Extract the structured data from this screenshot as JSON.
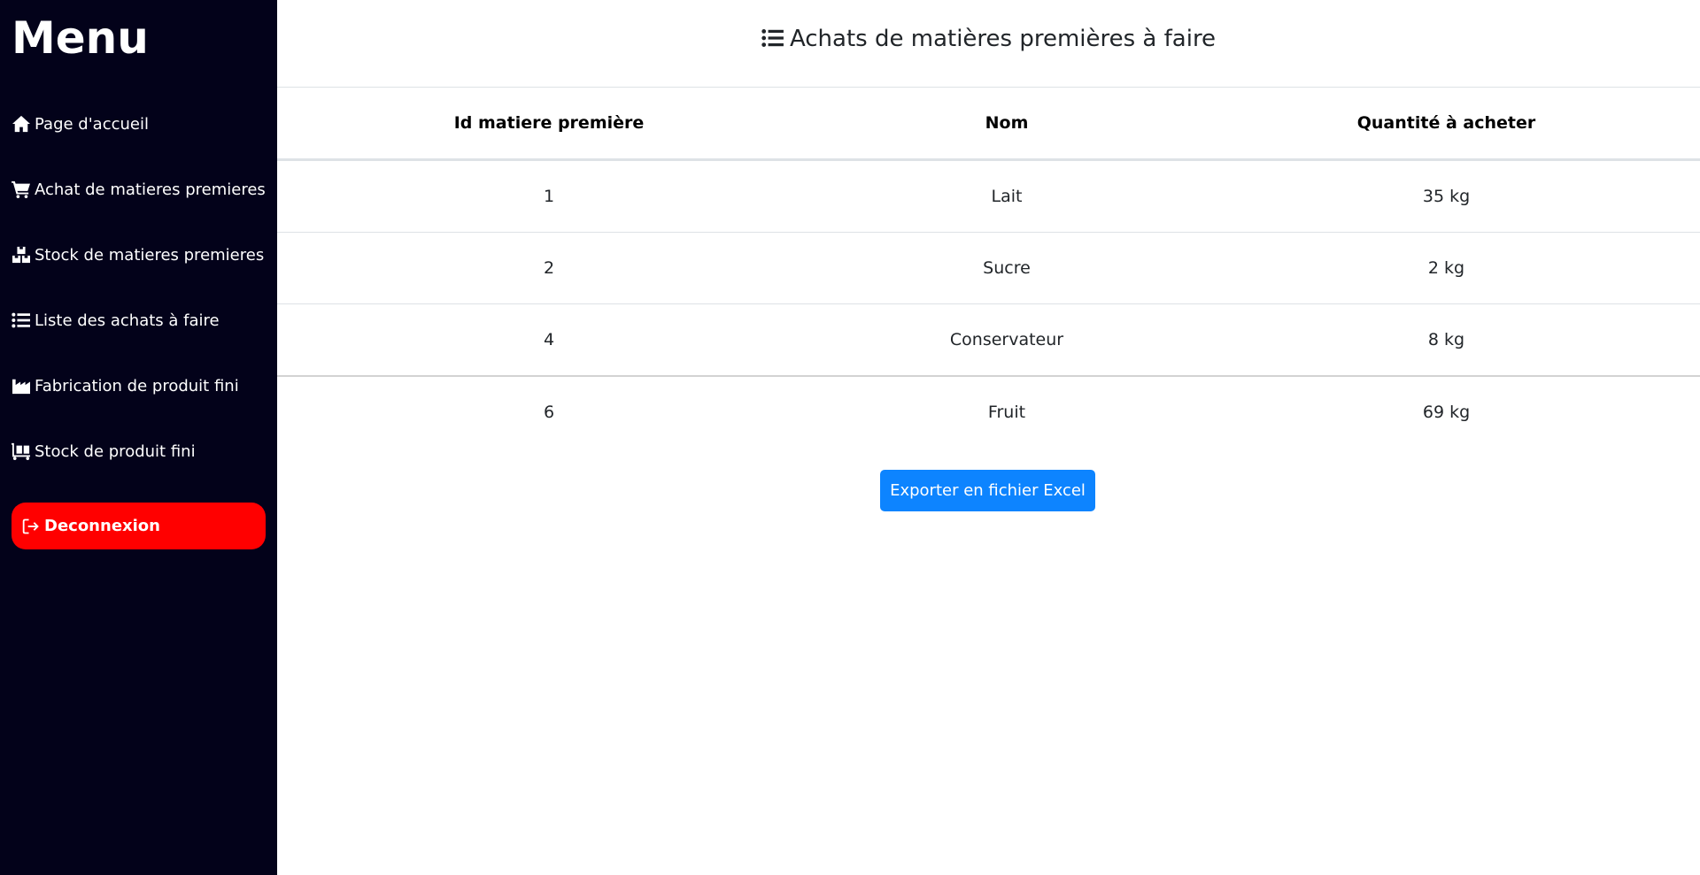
{
  "sidebar": {
    "title": "Menu",
    "items": [
      {
        "label": "Page d'accueil",
        "icon": "home-icon"
      },
      {
        "label": "Achat de matieres premieres",
        "icon": "cart-icon"
      },
      {
        "label": "Stock de matieres premieres",
        "icon": "boxes-icon"
      },
      {
        "label": "Liste des achats à faire",
        "icon": "list-icon"
      },
      {
        "label": "Fabrication de produit fini",
        "icon": "industry-icon"
      },
      {
        "label": "Stock de produit fini",
        "icon": "dolly-icon"
      }
    ],
    "logout": {
      "label": "Deconnexion",
      "icon": "sign-out-icon",
      "color": "#ff0000"
    }
  },
  "main": {
    "heading": "Achats de matières premières à faire",
    "table": {
      "columns": [
        "Id matiere première",
        "Nom",
        "Quantité à acheter"
      ],
      "rows": [
        {
          "id": "1",
          "nom": "Lait",
          "quantite": "35 kg"
        },
        {
          "id": "2",
          "nom": "Sucre",
          "quantite": "2 kg"
        },
        {
          "id": "4",
          "nom": "Conservateur",
          "quantite": "8 kg"
        },
        {
          "id": "6",
          "nom": "Fruit",
          "quantite": "69 kg"
        }
      ]
    },
    "export_button": "Exporter en fichier Excel"
  },
  "colors": {
    "sidebar_bg": "#03021a",
    "logout_bg": "#ff0000",
    "export_bg": "#0d84ff"
  }
}
